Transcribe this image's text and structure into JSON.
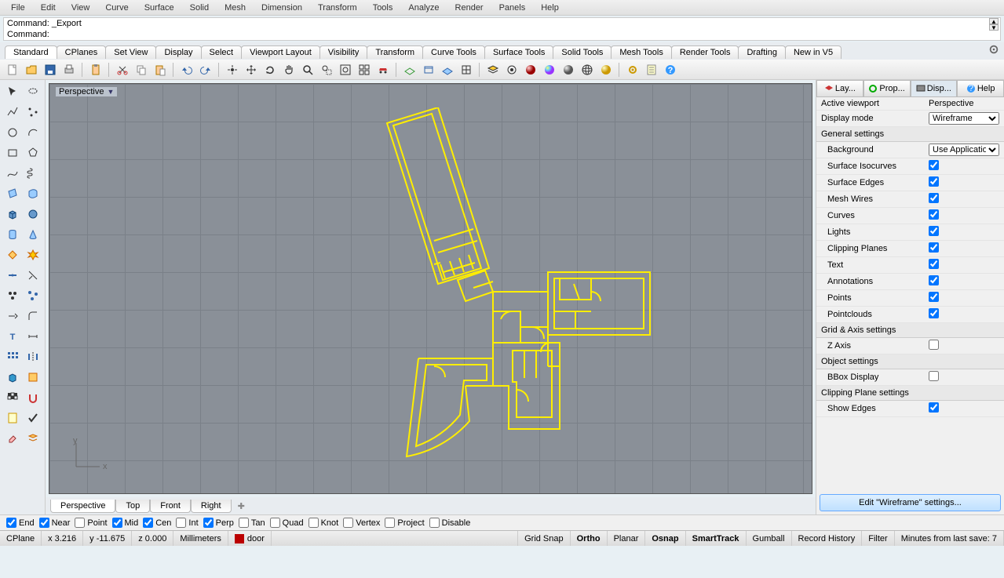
{
  "menu": [
    "File",
    "Edit",
    "View",
    "Curve",
    "Surface",
    "Solid",
    "Mesh",
    "Dimension",
    "Transform",
    "Tools",
    "Analyze",
    "Render",
    "Panels",
    "Help"
  ],
  "command_history": "Command: _Export",
  "command_prompt": "Command:",
  "toolbar_tabs": [
    "Standard",
    "CPlanes",
    "Set View",
    "Display",
    "Select",
    "Viewport Layout",
    "Visibility",
    "Transform",
    "Curve Tools",
    "Surface Tools",
    "Solid Tools",
    "Mesh Tools",
    "Render Tools",
    "Drafting",
    "New in V5"
  ],
  "toolbar_active": "Standard",
  "viewport": {
    "label": "Perspective"
  },
  "viewport_tabs": [
    "Perspective",
    "Top",
    "Front",
    "Right"
  ],
  "viewport_tab_active": "Perspective",
  "right_panel": {
    "tabs": [
      "Lay...",
      "Prop...",
      "Disp...",
      "Help"
    ],
    "active_tab": "Disp...",
    "active_viewport_label": "Active viewport",
    "active_viewport_value": "Perspective",
    "display_mode_label": "Display mode",
    "display_mode_value": "Wireframe",
    "sections": {
      "general": "General settings",
      "grid_axis": "Grid & Axis settings",
      "object": "Object settings",
      "clipping": "Clipping Plane settings"
    },
    "background_label": "Background",
    "background_value": "Use Application S...",
    "checks": {
      "surface_isocurves": {
        "label": "Surface Isocurves",
        "val": true
      },
      "surface_edges": {
        "label": "Surface Edges",
        "val": true
      },
      "mesh_wires": {
        "label": "Mesh Wires",
        "val": true
      },
      "curves": {
        "label": "Curves",
        "val": true
      },
      "lights": {
        "label": "Lights",
        "val": true
      },
      "clipping_planes": {
        "label": "Clipping Planes",
        "val": true
      },
      "text": {
        "label": "Text",
        "val": true
      },
      "annotations": {
        "label": "Annotations",
        "val": true
      },
      "points": {
        "label": "Points",
        "val": true
      },
      "pointclouds": {
        "label": "Pointclouds",
        "val": true
      },
      "z_axis": {
        "label": "Z Axis",
        "val": false
      },
      "bbox_display": {
        "label": "BBox Display",
        "val": false
      },
      "show_edges": {
        "label": "Show Edges",
        "val": true
      }
    },
    "edit_button": "Edit \"Wireframe\" settings..."
  },
  "osnaps": [
    {
      "label": "End",
      "checked": true
    },
    {
      "label": "Near",
      "checked": true
    },
    {
      "label": "Point",
      "checked": false
    },
    {
      "label": "Mid",
      "checked": true
    },
    {
      "label": "Cen",
      "checked": true
    },
    {
      "label": "Int",
      "checked": false
    },
    {
      "label": "Perp",
      "checked": true
    },
    {
      "label": "Tan",
      "checked": false
    },
    {
      "label": "Quad",
      "checked": false
    },
    {
      "label": "Knot",
      "checked": false
    },
    {
      "label": "Vertex",
      "checked": false
    },
    {
      "label": "Project",
      "checked": false
    },
    {
      "label": "Disable",
      "checked": false
    }
  ],
  "status": {
    "cplane": "CPlane",
    "x": "x 3.216",
    "y": "y -11.675",
    "z": "z 0.000",
    "units": "Millimeters",
    "layer": "door",
    "grid_snap": "Grid Snap",
    "ortho": "Ortho",
    "planar": "Planar",
    "osnap": "Osnap",
    "smarttrack": "SmartTrack",
    "gumball": "Gumball",
    "record_history": "Record History",
    "filter": "Filter",
    "save_msg": "Minutes from last save: 7"
  },
  "axis": {
    "x": "x",
    "y": "y"
  }
}
